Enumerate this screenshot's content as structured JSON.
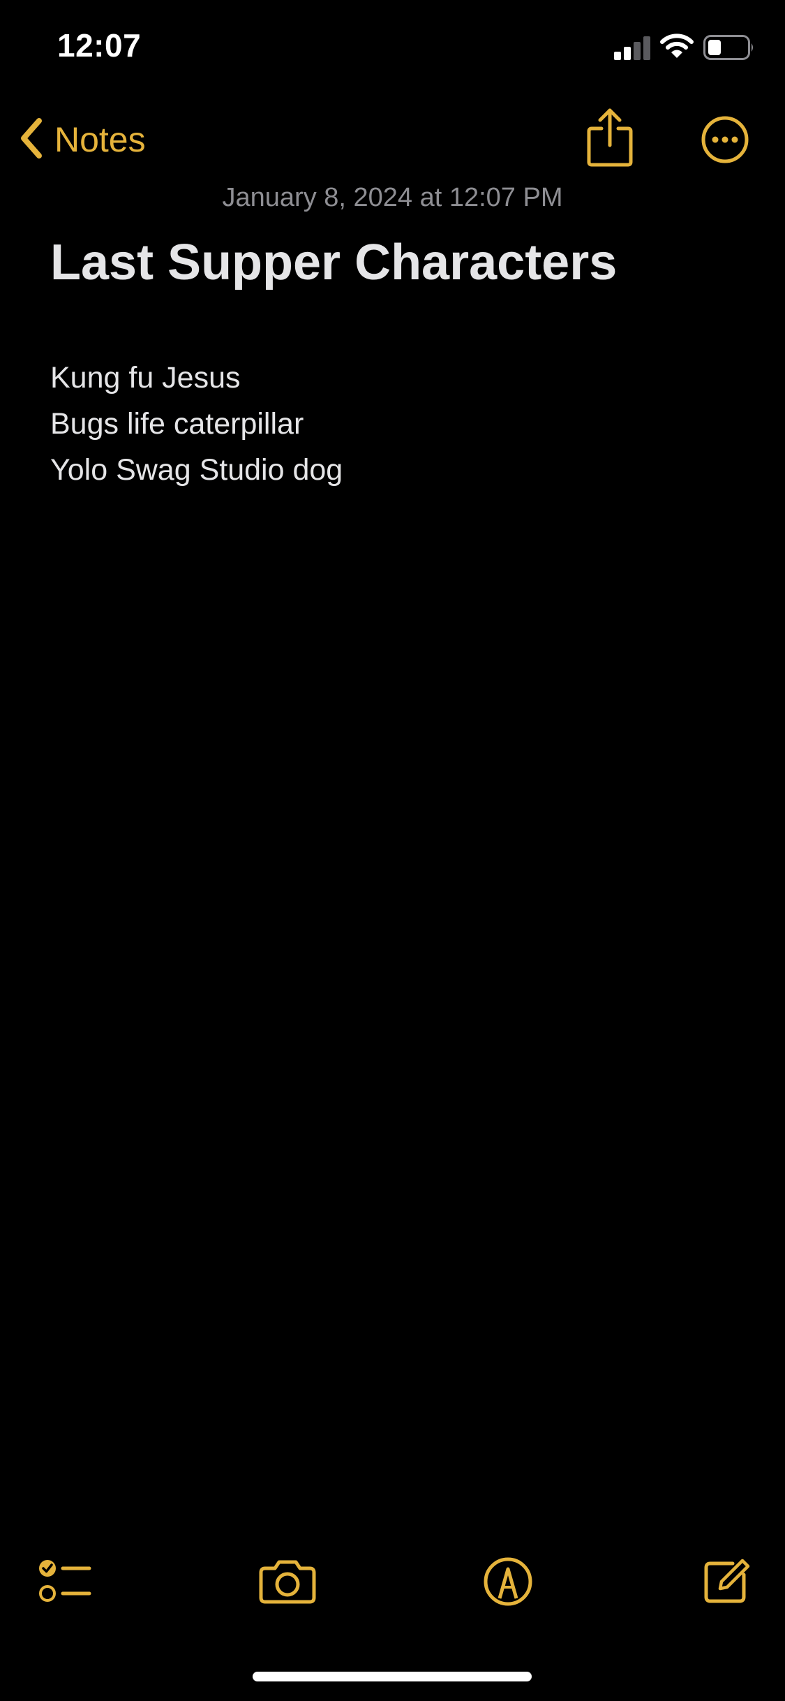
{
  "status_bar": {
    "time": "12:07",
    "icons": [
      "cellular-signal-icon",
      "wifi-icon",
      "battery-icon"
    ]
  },
  "nav": {
    "back_label": "Notes",
    "back_icon": "chevron-left-icon",
    "share_icon": "share-icon",
    "more_icon": "ellipsis-circle-icon"
  },
  "note": {
    "date": "January 8, 2024 at 12:07 PM",
    "title": "Last Supper Characters",
    "lines": [
      "Kung fu Jesus",
      "Bugs life caterpillar",
      "Yolo Swag Studio dog"
    ]
  },
  "toolbar": {
    "items": [
      "checklist-icon",
      "camera-icon",
      "markup-pen-icon",
      "compose-icon"
    ]
  },
  "colors": {
    "accent": "#e5b33b",
    "background": "#000000",
    "text": "#e5e5e7",
    "secondary_text": "#8e8e93"
  }
}
